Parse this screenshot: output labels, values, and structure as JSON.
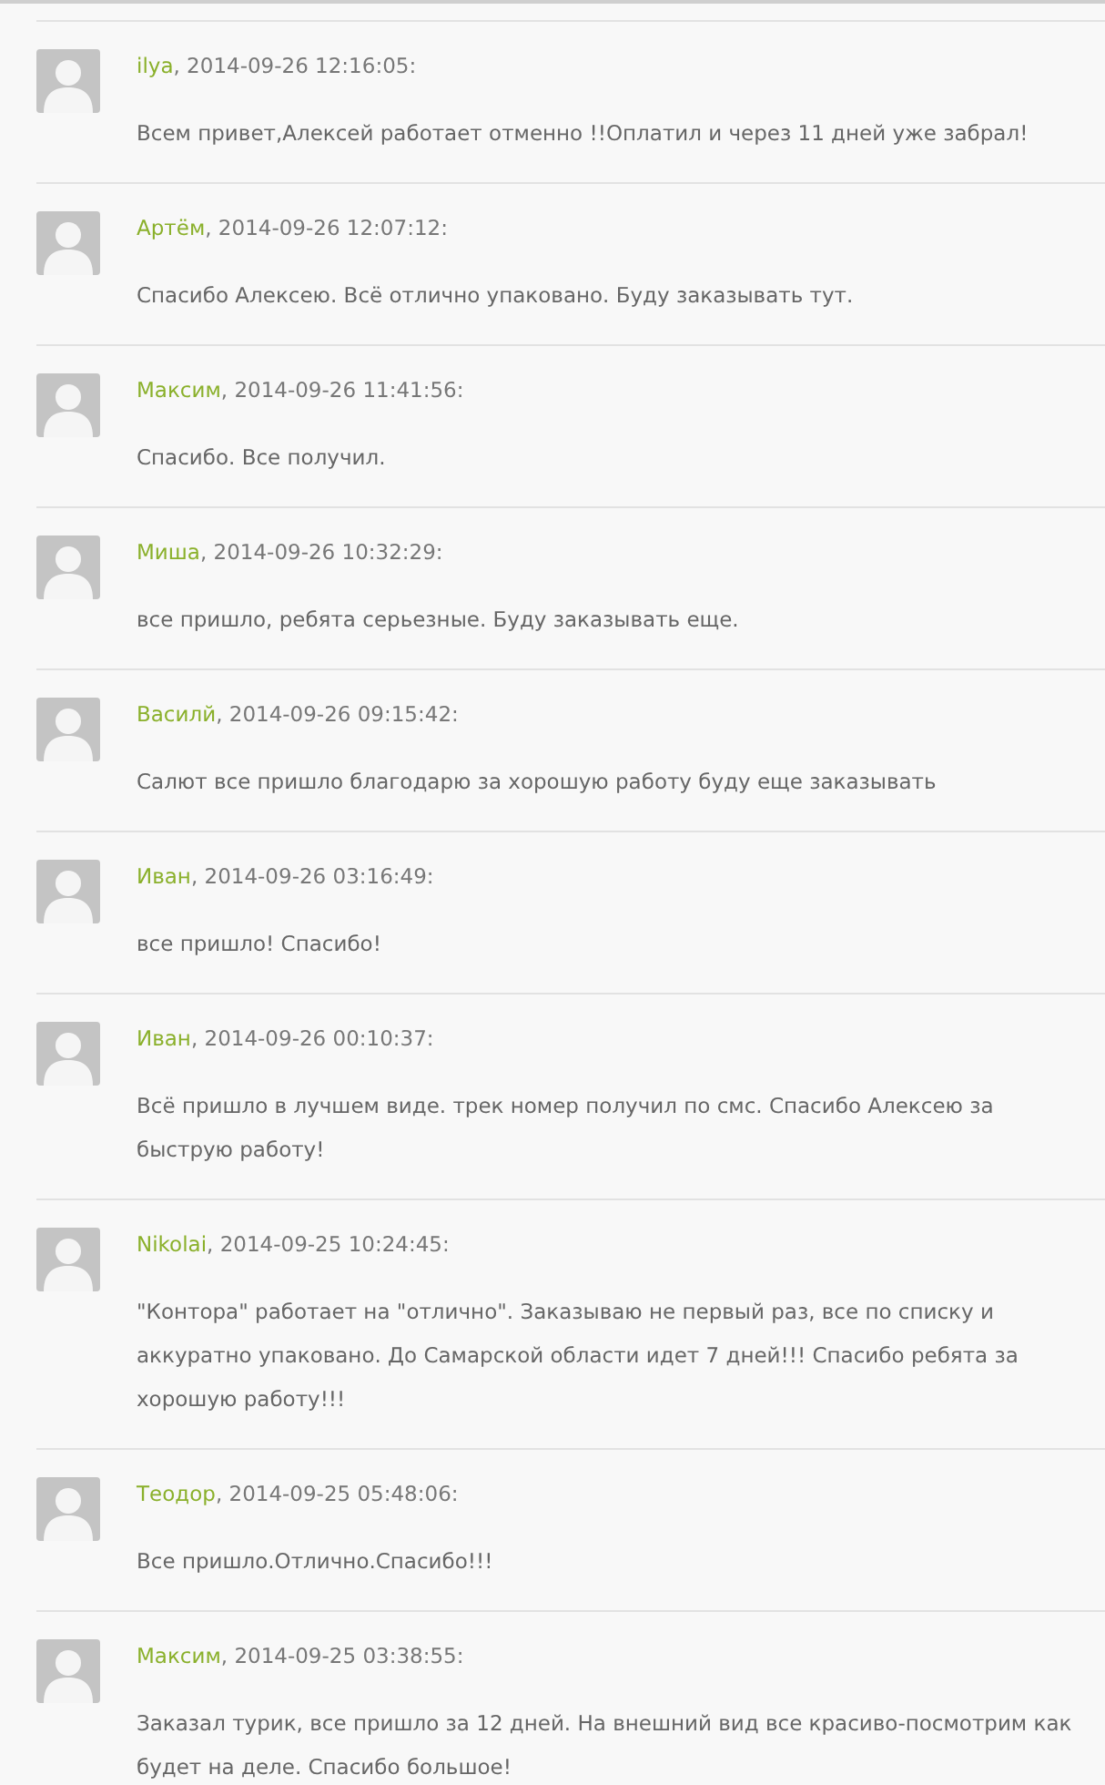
{
  "comments": [
    {
      "author": "ilya",
      "date": ", 2014-09-26 12:16:05:",
      "text": "Всем привет,Алексей работает отменно !!Оплатил и через 11 дней уже забрал!"
    },
    {
      "author": "Артём",
      "date": ", 2014-09-26 12:07:12:",
      "text": "Спасибо Алексею. Всё отлично упаковано. Буду заказывать тут."
    },
    {
      "author": "Максим",
      "date": ", 2014-09-26 11:41:56:",
      "text": "Спасибо. Все получил."
    },
    {
      "author": "Миша",
      "date": ", 2014-09-26 10:32:29:",
      "text": "все пришло, ребята серьезные. Буду заказывать еще."
    },
    {
      "author": "Василй",
      "date": ", 2014-09-26 09:15:42:",
      "text": "Салют все пришло благодарю за хорошую работу буду еще заказывать"
    },
    {
      "author": "Иван",
      "date": ", 2014-09-26 03:16:49:",
      "text": "все пришло! Спасибо!"
    },
    {
      "author": "Иван",
      "date": ", 2014-09-26 00:10:37:",
      "text": "Всё пришло в лучшем виде. трек номер получил по смс. Спасибо Алексею за быструю работу!"
    },
    {
      "author": "Nikolai",
      "date": ", 2014-09-25 10:24:45:",
      "text": "\"Контора\" работает на \"отлично\". Заказываю не первый раз, все по списку и аккуратно упаковано. До Самарской области идет 7 дней!!! Спасибо ребята за хорошую работу!!!"
    },
    {
      "author": "Теодор",
      "date": ", 2014-09-25 05:48:06:",
      "text": "Все пришло.Отлично.Спасибо!!!"
    },
    {
      "author": "Максим",
      "date": ", 2014-09-25 03:38:55:",
      "text": "Заказал турик, все пришло за 12 дней. На внешний вид все красиво-посмотрим как будет на деле. Спасибо большое!"
    }
  ]
}
